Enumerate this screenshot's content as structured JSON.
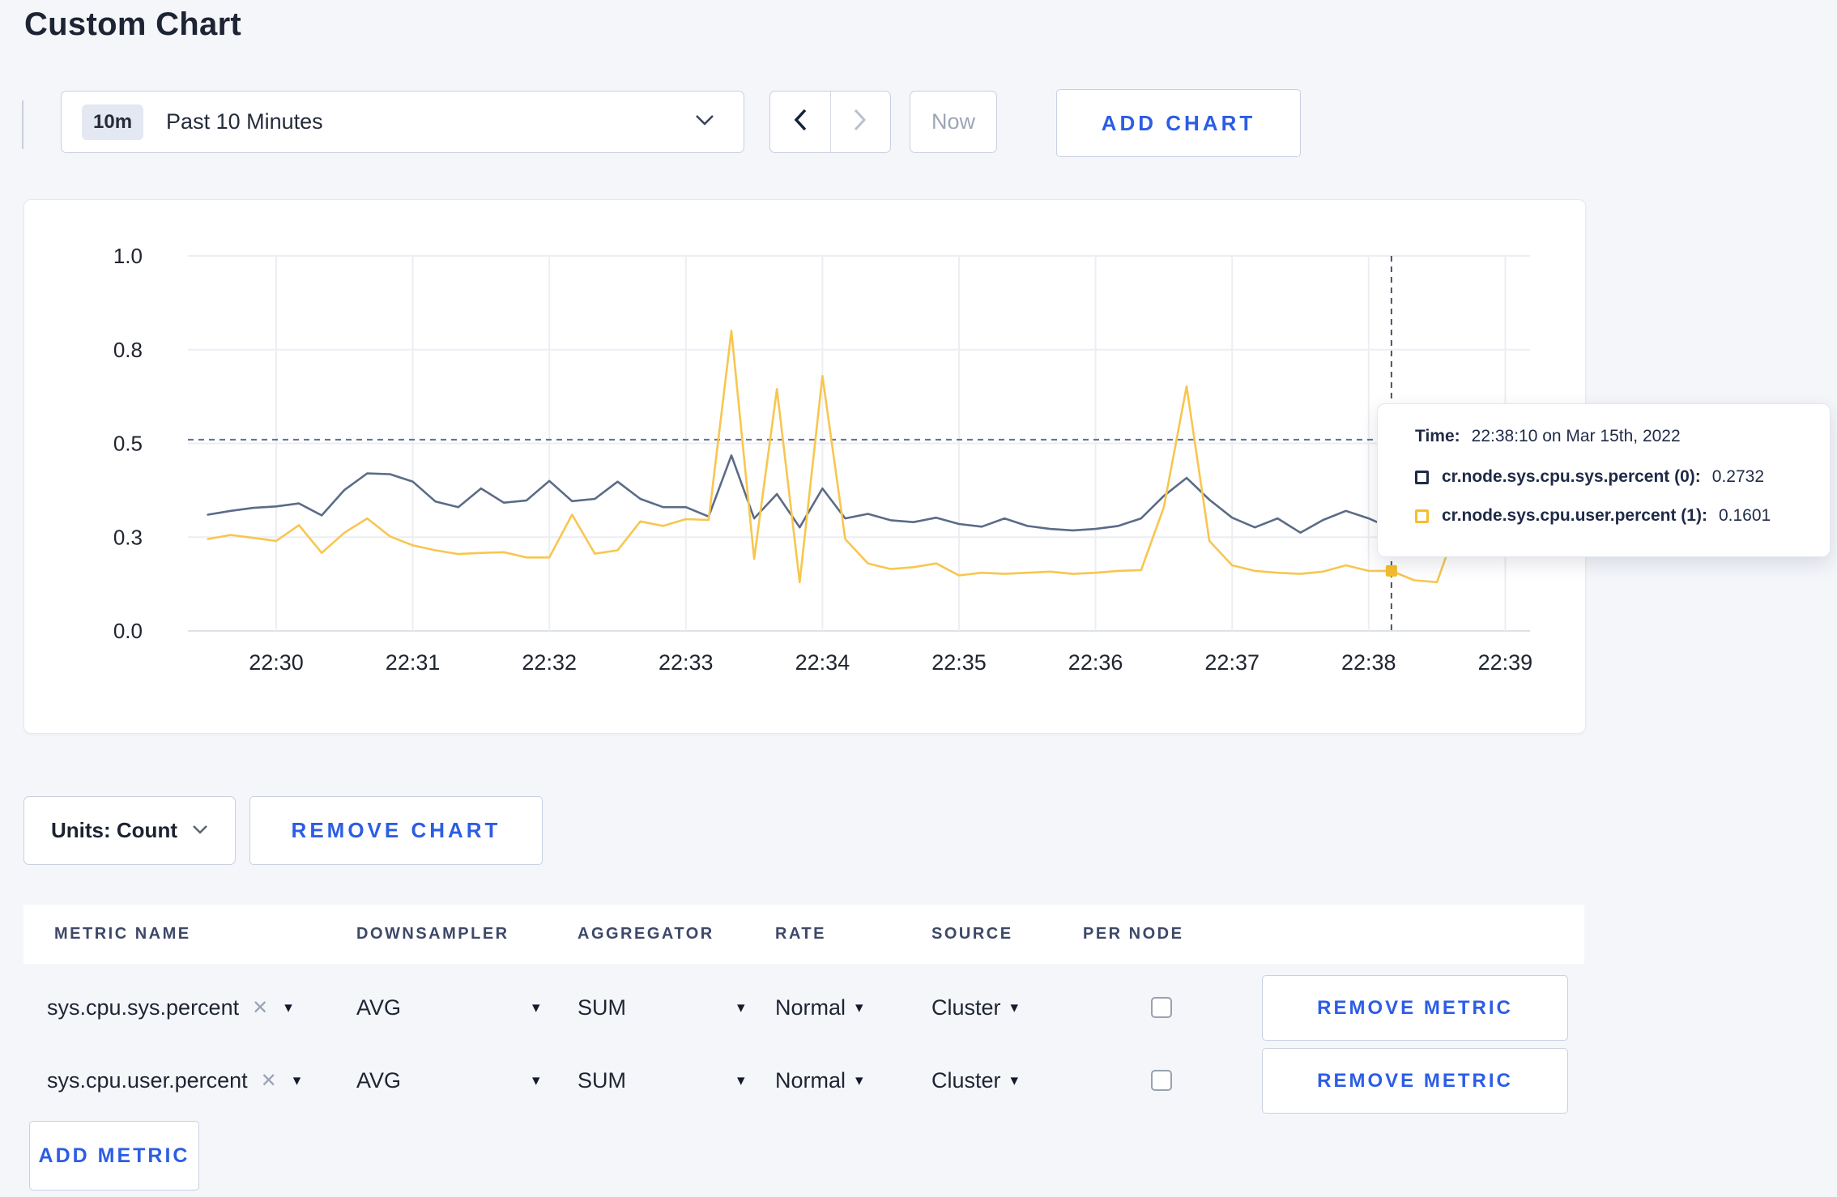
{
  "page": {
    "title": "Custom Chart",
    "background": "#F4F6FA",
    "accent_blue": "#2C5DE5"
  },
  "icons": {
    "caret_down_small": "▾",
    "close_x": "✕"
  },
  "toolbar": {
    "time_badge": "10m",
    "time_label": "Past 10 Minutes",
    "now_label": "Now",
    "add_chart_label": "ADD CHART"
  },
  "chart_data": {
    "type": "line",
    "title": "",
    "grid": true,
    "legend_position": "tooltip-overlay",
    "x_axis": {
      "tick_labels": [
        "22:30",
        "22:31",
        "22:32",
        "22:33",
        "22:34",
        "22:35",
        "22:36",
        "22:37",
        "22:38",
        "22:39"
      ],
      "start_time": "22:29:30",
      "interval_seconds": 10,
      "start_offset_minutes": -0.5
    },
    "y_axis": {
      "tick_labels": [
        "0.0",
        "0.3",
        "0.5",
        "0.8",
        "1.0"
      ],
      "tick_values": [
        0,
        0.25,
        0.5,
        0.75,
        1.0
      ],
      "range": [
        0,
        1
      ]
    },
    "series": [
      {
        "name": "cr.node.sys.cpu.sys.percent",
        "color": "#5B6B87",
        "values": [
          0.31,
          0.32,
          0.328,
          0.332,
          0.34,
          0.308,
          0.376,
          0.42,
          0.418,
          0.398,
          0.345,
          0.33,
          0.38,
          0.342,
          0.348,
          0.4,
          0.346,
          0.352,
          0.398,
          0.352,
          0.33,
          0.33,
          0.305,
          0.468,
          0.3,
          0.365,
          0.276,
          0.38,
          0.3,
          0.312,
          0.295,
          0.29,
          0.302,
          0.285,
          0.278,
          0.3,
          0.28,
          0.272,
          0.268,
          0.272,
          0.28,
          0.3,
          0.36,
          0.408,
          0.35,
          0.302,
          0.276,
          0.3,
          0.262,
          0.296,
          0.32,
          0.3,
          0.2732,
          0.296,
          0.288,
          0.296,
          0.3,
          0.298
        ]
      },
      {
        "name": "cr.node.sys.cpu.user.percent",
        "color": "#F8C64F",
        "values": [
          0.245,
          0.256,
          0.248,
          0.24,
          0.282,
          0.208,
          0.262,
          0.3,
          0.252,
          0.228,
          0.215,
          0.205,
          0.208,
          0.21,
          0.196,
          0.196,
          0.31,
          0.206,
          0.215,
          0.292,
          0.28,
          0.298,
          0.296,
          0.8,
          0.192,
          0.645,
          0.13,
          0.68,
          0.245,
          0.18,
          0.165,
          0.17,
          0.18,
          0.148,
          0.155,
          0.152,
          0.155,
          0.158,
          0.152,
          0.155,
          0.16,
          0.162,
          0.33,
          0.652,
          0.24,
          0.175,
          0.16,
          0.155,
          0.152,
          0.158,
          0.175,
          0.16,
          0.1601,
          0.135,
          0.13,
          0.3,
          0.25,
          0.265
        ]
      }
    ],
    "crosshair": {
      "time": "22:38:10",
      "x_offset_minutes": 8.1667,
      "hline_value": 0.51,
      "sys_value": 0.2732,
      "user_value": 0.1601
    }
  },
  "tooltip": {
    "time_label": "Time:",
    "time_value": "22:38:10 on Mar 15th, 2022",
    "series": [
      {
        "label": "cr.node.sys.cpu.sys.percent (0):",
        "value": "0.2732",
        "color": "#1F2A47"
      },
      {
        "label": "cr.node.sys.cpu.user.percent (1):",
        "value": "0.1601",
        "color": "#F5BE2C"
      }
    ]
  },
  "chart_controls": {
    "units_label": "Units: Count",
    "remove_chart_label": "REMOVE CHART"
  },
  "metrics_table": {
    "headers": {
      "metric": "METRIC NAME",
      "downsampler": "DOWNSAMPLER",
      "aggregator": "AGGREGATOR",
      "rate": "RATE",
      "source": "SOURCE",
      "per_node": "PER NODE"
    },
    "rows": [
      {
        "metric": "sys.cpu.sys.percent",
        "downsampler": "AVG",
        "aggregator": "SUM",
        "rate": "Normal",
        "source": "Cluster",
        "per_node_checked": false,
        "remove_label": "REMOVE METRIC"
      },
      {
        "metric": "sys.cpu.user.percent",
        "downsampler": "AVG",
        "aggregator": "SUM",
        "rate": "Normal",
        "source": "Cluster",
        "per_node_checked": false,
        "remove_label": "REMOVE METRIC"
      }
    ],
    "add_metric_label": "ADD METRIC"
  }
}
